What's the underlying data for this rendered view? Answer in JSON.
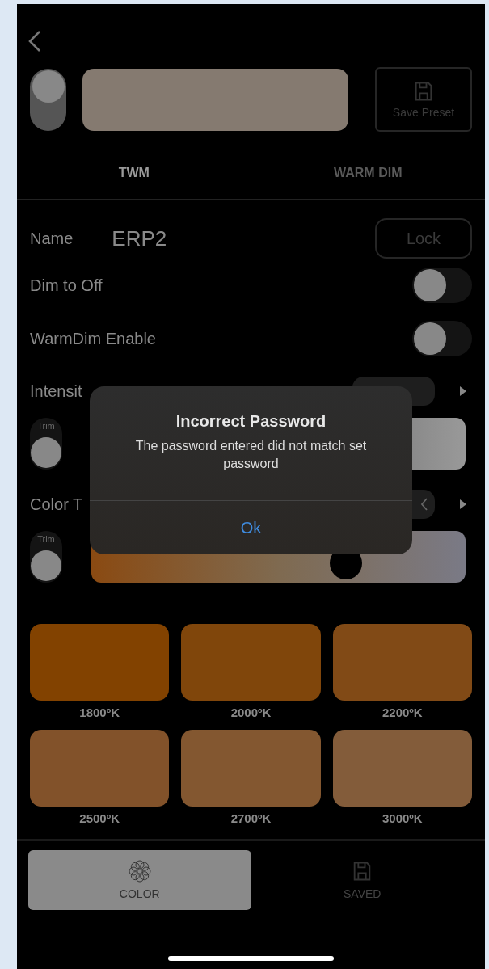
{
  "header": {
    "power_toggle": {
      "on": true
    },
    "preview": {
      "color": "#857a70"
    },
    "save_button": "Save Preset"
  },
  "mode_tabs": [
    {
      "label": "TWM",
      "selected": true
    },
    {
      "label": "WARM DIM",
      "selected": false
    }
  ],
  "name_row": {
    "label": "Name",
    "value": "ERP2",
    "lock_button": "Lock"
  },
  "switches": [
    {
      "label": "Dim to Off",
      "on": false
    },
    {
      "label": "WarmDim Enable",
      "on": false
    }
  ],
  "intensity": {
    "label": "Intensit",
    "trim": {
      "label": "Trim",
      "on": false
    }
  },
  "color_temp": {
    "label": "Color T",
    "trim": {
      "label": "Trim",
      "on": false
    },
    "level": 0.68
  },
  "swatches": [
    {
      "label": "1800ºK",
      "color": "#824200"
    },
    {
      "label": "2000ºK",
      "color": "#80460b"
    },
    {
      "label": "2200ºK",
      "color": "#814a16"
    },
    {
      "label": "2500ºK",
      "color": "#82522a"
    },
    {
      "label": "2700ºK",
      "color": "#835730"
    },
    {
      "label": "3000ºK",
      "color": "#835c3a"
    }
  ],
  "bottom_tabs": [
    {
      "label": "COLOR",
      "kind": "color",
      "selected": true
    },
    {
      "label": "SAVED",
      "kind": "saved",
      "selected": false
    }
  ],
  "dialog": {
    "title": "Incorrect Password",
    "message": "The password entered did not match set password",
    "button": "Ok"
  }
}
